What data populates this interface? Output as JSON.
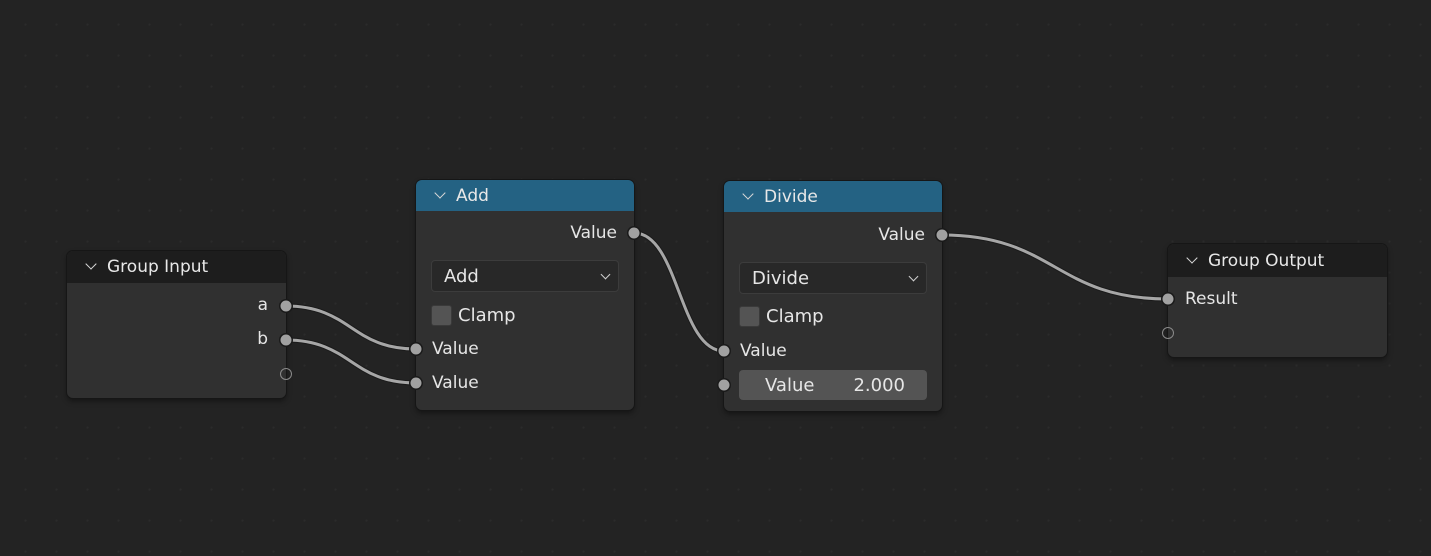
{
  "editor": {
    "type": "node-editor",
    "link_color": "#a6a6a6",
    "header_colors": {
      "group": "#1d1d1d",
      "math": "#246283"
    }
  },
  "nodes": {
    "group_input": {
      "title": "Group Input",
      "outputs": [
        {
          "label": "a"
        },
        {
          "label": "b"
        },
        {
          "label": ""
        }
      ]
    },
    "add": {
      "title": "Add",
      "output_label": "Value",
      "operation": "Add",
      "clamp_label": "Clamp",
      "clamp_checked": false,
      "inputs": [
        {
          "label": "Value"
        },
        {
          "label": "Value"
        }
      ]
    },
    "divide": {
      "title": "Divide",
      "output_label": "Value",
      "operation": "Divide",
      "clamp_label": "Clamp",
      "clamp_checked": false,
      "inputs": [
        {
          "label": "Value"
        },
        {
          "label": "Value",
          "value": "2.000"
        }
      ]
    },
    "group_output": {
      "title": "Group Output",
      "inputs": [
        {
          "label": "Result"
        },
        {
          "label": ""
        }
      ]
    }
  },
  "links": [
    {
      "from": "group_input.a",
      "to": "add.input0"
    },
    {
      "from": "group_input.b",
      "to": "add.input1"
    },
    {
      "from": "add.output",
      "to": "divide.input0"
    },
    {
      "from": "divide.output",
      "to": "group_output.result"
    }
  ]
}
